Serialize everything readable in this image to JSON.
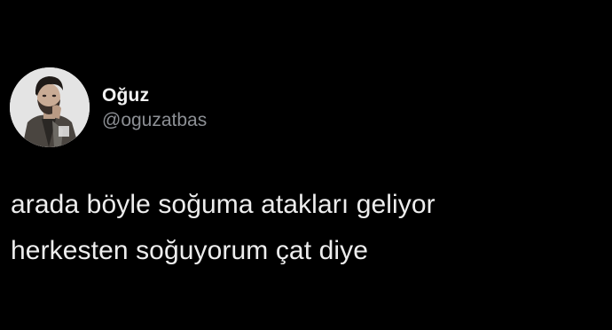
{
  "theme": {
    "background": "#000000",
    "text_primary": "#ededed",
    "text_secondary": "#8c8f94"
  },
  "author": {
    "display_name": "Oğuz",
    "handle": "@oguzatbas",
    "avatar_icon": "profile-photo-avatar"
  },
  "tweet": {
    "lines": [
      "arada böyle soğuma atakları geliyor",
      "herkesten soğuyorum çat diye"
    ]
  }
}
